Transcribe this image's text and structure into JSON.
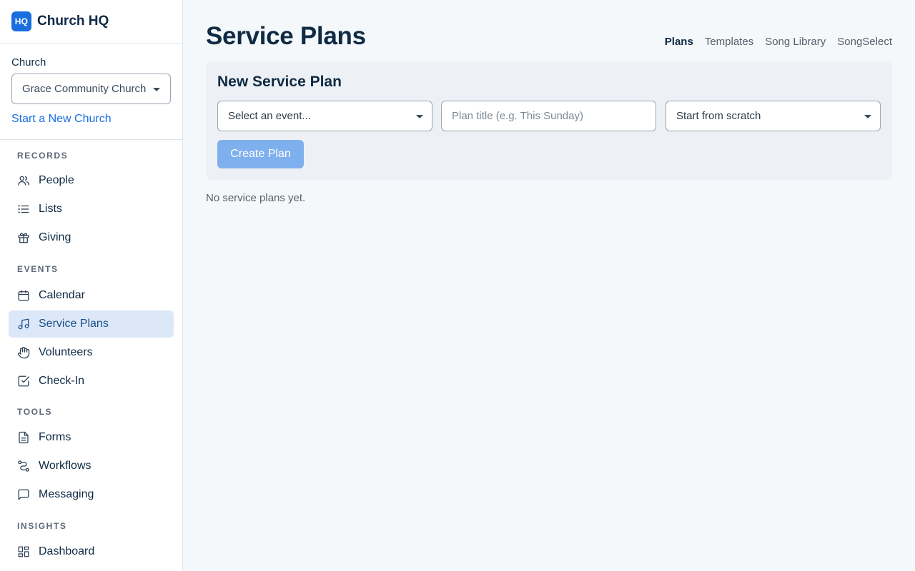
{
  "brand": {
    "logo_text": "HQ",
    "name": "Church HQ",
    "accent": "#1a6fe0"
  },
  "church": {
    "label": "Church",
    "selected": "Grace Community Church",
    "new_link": "Start a New Church"
  },
  "nav": [
    {
      "title": "RECORDS",
      "items": [
        {
          "label": "People",
          "icon": "people-icon"
        },
        {
          "label": "Lists",
          "icon": "list-icon"
        },
        {
          "label": "Giving",
          "icon": "gift-icon"
        }
      ]
    },
    {
      "title": "EVENTS",
      "items": [
        {
          "label": "Calendar",
          "icon": "calendar-icon"
        },
        {
          "label": "Service Plans",
          "icon": "music-note-icon",
          "active": true
        },
        {
          "label": "Volunteers",
          "icon": "hand-icon"
        },
        {
          "label": "Check-In",
          "icon": "checkbox-icon"
        }
      ]
    },
    {
      "title": "TOOLS",
      "items": [
        {
          "label": "Forms",
          "icon": "document-icon"
        },
        {
          "label": "Workflows",
          "icon": "workflow-icon"
        },
        {
          "label": "Messaging",
          "icon": "message-icon"
        }
      ]
    },
    {
      "title": "INSIGHTS",
      "items": [
        {
          "label": "Dashboard",
          "icon": "dashboard-icon"
        }
      ]
    }
  ],
  "page": {
    "title": "Service Plans",
    "tabs": [
      {
        "label": "Plans",
        "active": true
      },
      {
        "label": "Templates"
      },
      {
        "label": "Song Library"
      },
      {
        "label": "SongSelect"
      }
    ]
  },
  "new_plan": {
    "title": "New Service Plan",
    "event_select": "Select an event...",
    "title_placeholder": "Plan title (e.g. This Sunday)",
    "template_select": "Start from scratch",
    "create_label": "Create Plan"
  },
  "empty_state": "No service plans yet."
}
